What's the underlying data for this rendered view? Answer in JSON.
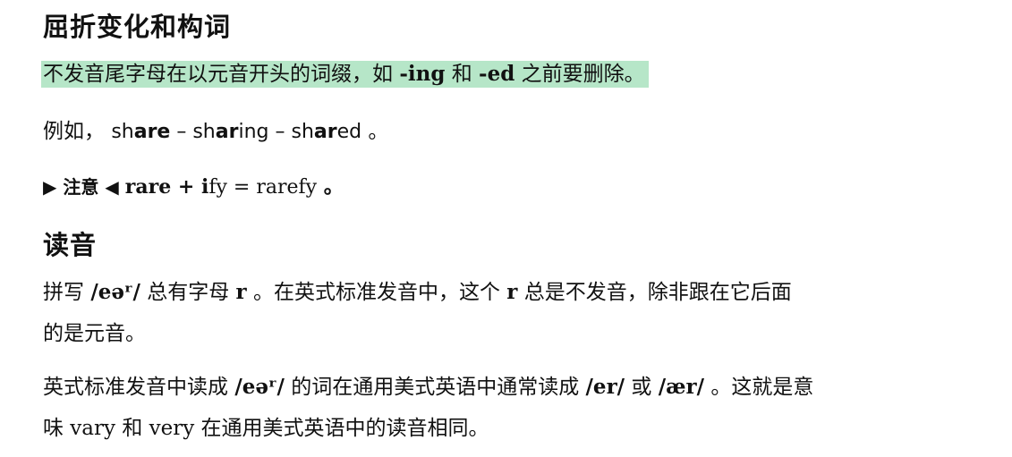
{
  "section1": {
    "title": "屈折变化和构词",
    "rule": {
      "t1": "不发音尾字母在以元音开头的词缀，如",
      "ing": "-ing",
      "t2": "和",
      "ed": "-ed",
      "t3": "之前要删除。"
    },
    "example": {
      "lead": "例如，",
      "w1a": "sh",
      "w1b": "are",
      "dash1": " – ",
      "w2a": "sh",
      "w2b": "ar",
      "w2c": "ing",
      "dash2": " – ",
      "w3a": "sh",
      "w3b": "ar",
      "w3c": "ed",
      "end": " 。"
    },
    "note": {
      "arrow_left": "▶",
      "label": "注意",
      "arrow_right": "◀",
      "f1": "rare + ",
      "f2": "i",
      "f3": "fy = rarefy",
      "end": " 。"
    }
  },
  "section2": {
    "title": "读音",
    "para1": {
      "t1": "拼写",
      "ipa1": "/eəʳ/",
      "t2": "总有字母",
      "r1": "r",
      "t3": "。在英式标准发音中，这个",
      "r2": "r",
      "t4": "总是不发音，除非跟在它后面",
      "line2": "的是元音。"
    },
    "para2": {
      "t1": "英式标准发音中读成",
      "ipa1": "/eəʳ/",
      "t2": "的词在通用美式英语中通常读成",
      "ipa2": "/er/",
      "t3": "或",
      "ipa3": "/ær/",
      "t4": "。这就是意",
      "line2": "味 vary 和 very 在通用美式英语中的读音相同。"
    }
  }
}
